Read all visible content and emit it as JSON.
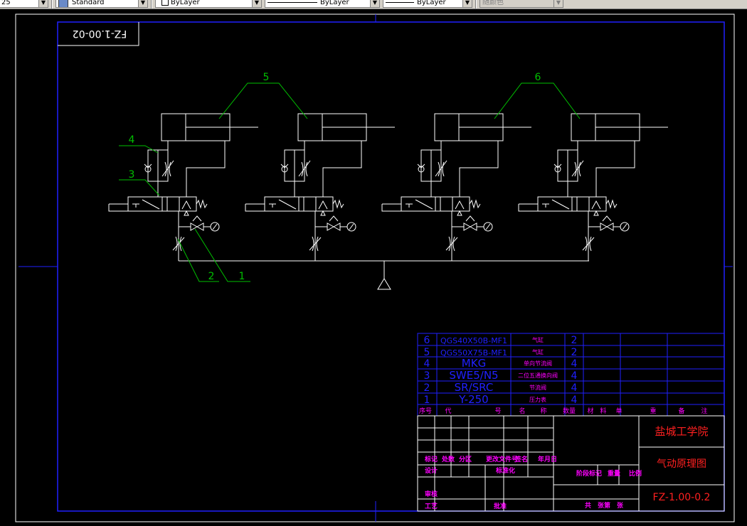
{
  "toolbar": {
    "layer_combo": "25",
    "style_combo": "Standard",
    "color_combo": "ByLayer",
    "linetype_combo": "ByLayer",
    "lineweight_combo": "ByLayer",
    "plotstyle_combo": "随颜色"
  },
  "drawing": {
    "code_box": "FZ-1.00-02",
    "balloons": [
      "5",
      "6",
      "4",
      "3",
      "2",
      "1"
    ]
  },
  "parts_list": {
    "rows": [
      {
        "no": "6",
        "code": "QGS40X50B-MF1",
        "name": "气缸",
        "qty": "2"
      },
      {
        "no": "5",
        "code": "QGS50X75B-MF1",
        "name": "气缸",
        "qty": "2"
      },
      {
        "no": "4",
        "code": "MKG",
        "name": "单向节流阀",
        "qty": "4"
      },
      {
        "no": "3",
        "code": "SWE5/N5",
        "name": "二位五通换向阀",
        "qty": "4"
      },
      {
        "no": "2",
        "code": "SR/SRC",
        "name": "节流阀",
        "qty": "4"
      },
      {
        "no": "1",
        "code": "Y-250",
        "name": "压力表",
        "qty": "4"
      }
    ],
    "header": [
      "序号",
      "代",
      "号",
      "名",
      "称",
      "数量",
      "材",
      "料",
      "单",
      "重",
      "备",
      "注"
    ]
  },
  "title_block": {
    "school": "盐城工学院",
    "drawing_title": "气动原理图",
    "drawing_number": "FZ-1.00-0.2",
    "sign_row": [
      "标记",
      "处数",
      "分区",
      "更改文件号",
      "签名",
      "年月日"
    ],
    "design": "设计",
    "standardize": "标准化",
    "stage_mark": "阶段标记",
    "weight": "重量",
    "scale": "比例",
    "review": "审核",
    "process": "工艺",
    "approve": "批准",
    "sheets": "共　张第　张"
  },
  "colors": {
    "background": "#000000",
    "line": "#ffffff",
    "leader": "#00c000",
    "frame": "#2020ff",
    "table_text": "#ff00ff",
    "title_text": "#ff2020"
  }
}
